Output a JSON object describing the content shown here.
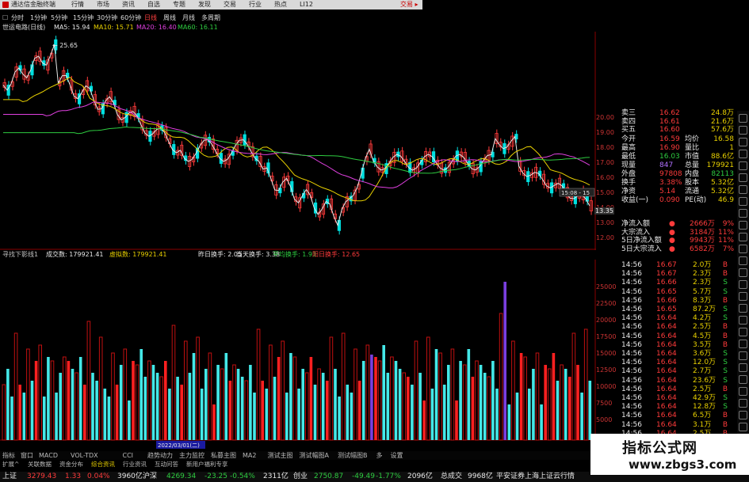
{
  "top_bar": {
    "app_title": "通达信金融终端",
    "menus": [
      "行情",
      "市场",
      "资讯",
      "自选",
      "专题",
      "发现",
      "交易",
      "行业",
      "热点",
      "LI12"
    ],
    "trade_label": "交易 ▸"
  },
  "period_bar": {
    "items": [
      "分时",
      "1分钟",
      "5分钟",
      "15分钟",
      "30分钟",
      "60分钟",
      "日线",
      "周线",
      "月线",
      "多周期"
    ],
    "active": "日线"
  },
  "price_chart": {
    "stock_label": "世运电路(日线)",
    "ma": [
      {
        "label": "MA5: 15.94",
        "color": "#e8e8e8"
      },
      {
        "label": "MA10: 15.71",
        "color": "#e8d000"
      },
      {
        "label": "MA20: 16.40",
        "color": "#e040e0"
      },
      {
        "label": "MA60: 16.11",
        "color": "#2ecc40"
      }
    ],
    "high_marker": "25.65",
    "crosshair_time": "15:08 - 15",
    "crosshair_price": "13.35",
    "axis_ticks": [
      "20.00",
      "19.00",
      "18.00",
      "17.00",
      "16.00",
      "15.00",
      "14.00",
      "13.00",
      "12.00"
    ]
  },
  "quote_panel": {
    "asks": [
      {
        "label": "卖三",
        "price": "16.62",
        "vol": "24.8万"
      },
      {
        "label": "卖四",
        "price": "16.61",
        "vol": "21.6万"
      },
      {
        "label": "买五",
        "price": "16.60",
        "vol": "57.6万"
      }
    ],
    "stats": [
      {
        "k1": "今开",
        "v1": "16.59",
        "k2": "均价",
        "v2": "16.58"
      },
      {
        "k1": "最高",
        "v1": "16.90",
        "k2": "量比",
        "v2": "1"
      },
      {
        "k1": "最低",
        "v1": "16.03",
        "k2": "市值",
        "v2": "88.6亿"
      },
      {
        "k1": "现量",
        "v1": "847",
        "k2": "总量",
        "v2": "179921"
      },
      {
        "k1": "外盘",
        "v1": "97808",
        "k2": "内盘",
        "v2": "82113"
      },
      {
        "k1": "换手",
        "v1": "3.38%",
        "k2": "股本",
        "v2": "5.32亿"
      },
      {
        "k1": "净资",
        "v1": "5.14",
        "k2": "流通",
        "v2": "5.32亿"
      },
      {
        "k1": "收益(一)",
        "v1": "0.090",
        "k2": "PE(动)",
        "v2": "46.9"
      }
    ]
  },
  "fund_flow": [
    {
      "label": "净流入额",
      "value": "2666万",
      "pct": "9%"
    },
    {
      "label": "大宗流入",
      "value": "3184万",
      "pct": "11%"
    },
    {
      "label": "5日净流入额",
      "value": "9943万",
      "pct": "11%"
    },
    {
      "label": "5日大宗流入",
      "value": "6582万",
      "pct": "7%"
    }
  ],
  "ticks": [
    {
      "t": "14:56",
      "p": "16.67",
      "v": "2.0万",
      "s": "B"
    },
    {
      "t": "14:56",
      "p": "16.67",
      "v": "2.3万",
      "s": "B"
    },
    {
      "t": "14:56",
      "p": "16.66",
      "v": "2.3万",
      "s": "S"
    },
    {
      "t": "14:56",
      "p": "16.65",
      "v": "5.7万",
      "s": "S"
    },
    {
      "t": "14:56",
      "p": "16.66",
      "v": "8.3万",
      "s": "B"
    },
    {
      "t": "14:56",
      "p": "16.65",
      "v": "87.2万",
      "s": "S"
    },
    {
      "t": "14:56",
      "p": "16.64",
      "v": "4.2万",
      "s": "S"
    },
    {
      "t": "14:56",
      "p": "16.64",
      "v": "2.5万",
      "s": "B"
    },
    {
      "t": "14:56",
      "p": "16.64",
      "v": "4.5万",
      "s": "B"
    },
    {
      "t": "14:56",
      "p": "16.64",
      "v": "3.5万",
      "s": "B"
    },
    {
      "t": "14:56",
      "p": "16.64",
      "v": "3.6万",
      "s": "S"
    },
    {
      "t": "14:56",
      "p": "16.64",
      "v": "12.0万",
      "s": "S"
    },
    {
      "t": "14:56",
      "p": "16.64",
      "v": "2.7万",
      "s": "S"
    },
    {
      "t": "14:56",
      "p": "16.64",
      "v": "23.6万",
      "s": "S"
    },
    {
      "t": "14:56",
      "p": "16.64",
      "v": "2.5万",
      "s": "B"
    },
    {
      "t": "14:56",
      "p": "16.64",
      "v": "42.9万",
      "s": "S"
    },
    {
      "t": "14:56",
      "p": "16.64",
      "v": "12.8万",
      "s": "S"
    },
    {
      "t": "14:56",
      "p": "16.64",
      "v": "6.5万",
      "s": "B"
    },
    {
      "t": "14:56",
      "p": "16.64",
      "v": "3.1万",
      "s": "B"
    },
    {
      "t": "14:56",
      "p": "16.64",
      "v": "2.5万",
      "s": "B"
    }
  ],
  "volume_panel": {
    "items": [
      {
        "label": "寻找下影线1",
        "color": "#c0c0c0"
      },
      {
        "label": "成交数: 179921.41",
        "color": "#e8e8e8"
      },
      {
        "label": "虚拟数: 179921.41",
        "color": "#e8d000"
      },
      {
        "label": "昨日换手: 2.05",
        "color": "#e8e8e8"
      },
      {
        "label": "当天换手: 3.38",
        "color": "#e8e8e8"
      },
      {
        "label": "平均换手: 1.93",
        "color": "#2ecc40"
      },
      {
        "label": "阳日换手: 12.65",
        "color": "#ff3b3b"
      }
    ],
    "axis_ticks": [
      "25000",
      "22500",
      "20000",
      "17500",
      "15000",
      "12500",
      "10000",
      "7500",
      "5000",
      "2500"
    ],
    "date_label": "2022/03/01(二)"
  },
  "tabs": [
    "指标",
    "窗口",
    "MACD",
    "VOL-TDX",
    "CCI",
    "趋势动力",
    "主力监控",
    "私募主图",
    "MA2",
    "测试主图",
    "测试幅图A",
    "测试幅图B",
    "多",
    "设置"
  ],
  "info_bar": [
    "扩展^",
    "关联数据",
    "资金分布",
    "综合资讯",
    "行业资讯",
    "互动问答",
    "新用户福利专享"
  ],
  "status_bar": [
    {
      "text": "上证",
      "color": "#e8e8e8"
    },
    {
      "text": "3279.43",
      "color": "#ff3b3b"
    },
    {
      "text": "1.33",
      "color": "#ff3b3b"
    },
    {
      "text": "0.04%",
      "color": "#ff3b3b"
    },
    {
      "text": "3960亿",
      "color": "#e8e8e8"
    },
    {
      "text": "沪深",
      "color": "#e8e8e8"
    },
    {
      "text": "4269.34",
      "color": "#2ecc40"
    },
    {
      "text": "-23.25",
      "color": "#2ecc40"
    },
    {
      "text": "-0.54%",
      "color": "#2ecc40"
    },
    {
      "text": "2311亿",
      "color": "#e8e8e8"
    },
    {
      "text": "创业",
      "color": "#e8e8e8"
    },
    {
      "text": "2750.87",
      "color": "#2ecc40"
    },
    {
      "text": "-49.49",
      "color": "#2ecc40"
    },
    {
      "text": "-1.77%",
      "color": "#2ecc40"
    },
    {
      "text": "2096亿",
      "color": "#e8e8e8"
    },
    {
      "text": "总成交",
      "color": "#e8e8e8"
    },
    {
      "text": "9968亿",
      "color": "#e8e8e8"
    },
    {
      "text": "平安证券上海上证云行情",
      "color": "#e8e8e8"
    }
  ],
  "watermark": {
    "title": "指标公式网",
    "url": "www.zbgs3.com"
  }
}
